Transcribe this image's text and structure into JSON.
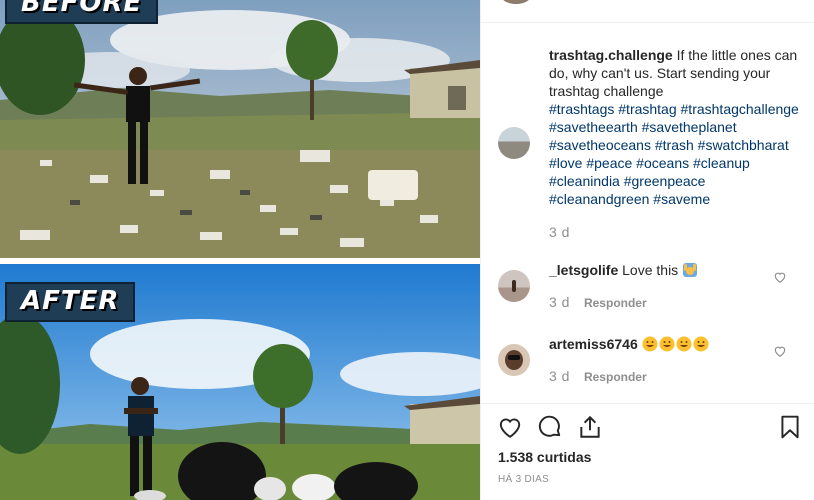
{
  "photo": {
    "before_label": "BEFORE",
    "after_label": "AFTER"
  },
  "post": {
    "caption_user": "trashtag.challenge",
    "caption_text": " If the little ones can do, why can't us. Start sending your trashtag challenge",
    "hashtags": "#trashtags #trashtag #trashtagchallenge #savetheearth #savetheplanet #savetheoceans #trash #swatchbharat #love #peace #oceans #cleanup #cleanindia #greenpeace #cleanandgreen #saveme",
    "age": "3 d"
  },
  "comments": [
    {
      "user": "_letsgolife",
      "text": " Love this ",
      "emoji": [
        "raised-hands-emoji"
      ],
      "age": "3 d",
      "reply_label": "Responder"
    },
    {
      "user": "artemiss6746",
      "text": " ",
      "emoji": [
        "grinning-emoji",
        "grinning-emoji",
        "grinning-emoji",
        "grinning-emoji"
      ],
      "age": "3 d",
      "reply_label": "Responder"
    }
  ],
  "footer": {
    "likes": "1.538 curtidas",
    "date": "HÁ 3 DIAS"
  },
  "colors": {
    "hashtag": "#00376b",
    "muted": "#8e8e8e",
    "text": "#262626"
  }
}
